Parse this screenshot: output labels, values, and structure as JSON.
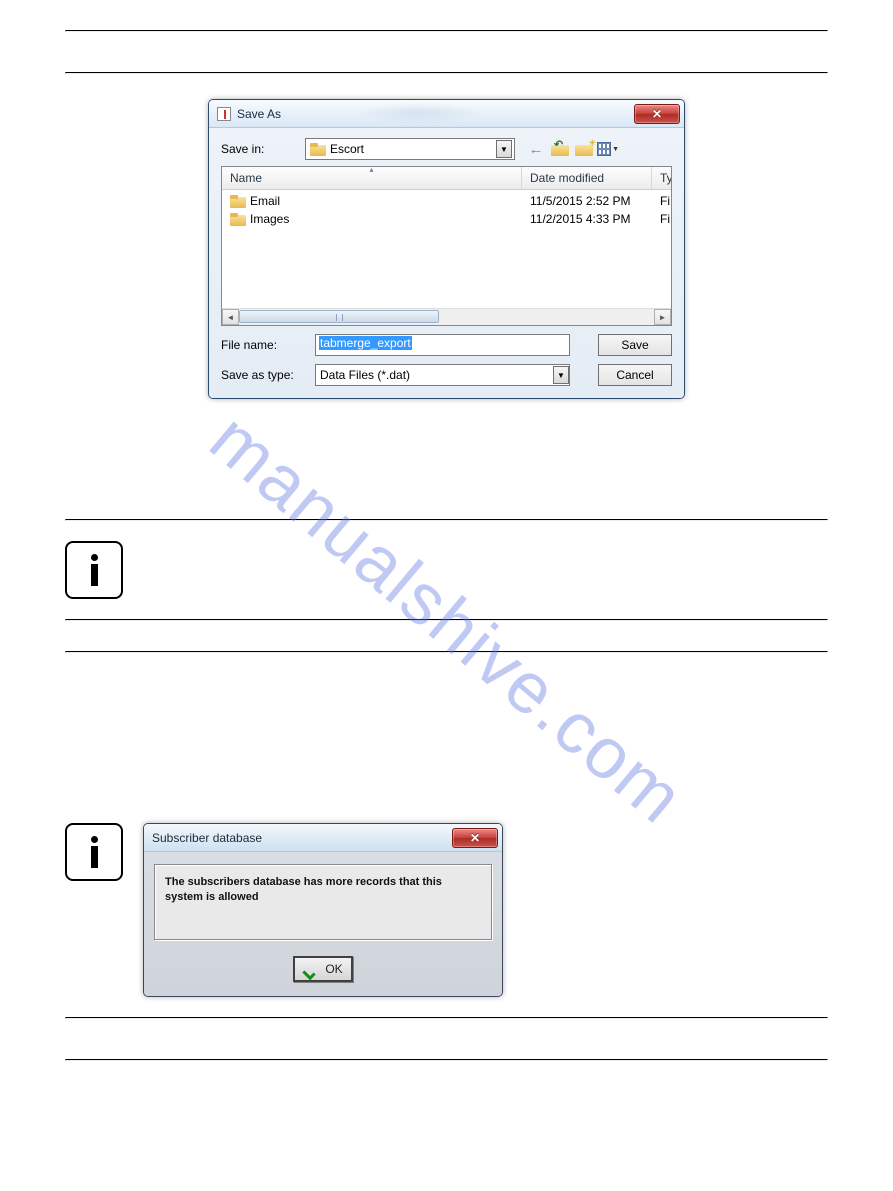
{
  "watermark": "manualshive.com",
  "saveas_dialog": {
    "title": "Save As",
    "labels": {
      "save_in": "Save in:",
      "file_name": "File name:",
      "save_as_type": "Save as type:"
    },
    "save_in_folder": "Escort",
    "columns": {
      "name": "Name",
      "date_modified": "Date modified",
      "type": "Ty"
    },
    "rows": [
      {
        "name": "Email",
        "date": "11/5/2015 2:52 PM",
        "type": "Fi"
      },
      {
        "name": "Images",
        "date": "11/2/2015 4:33 PM",
        "type": "Fi"
      }
    ],
    "file_name_value": "tabmerge_export",
    "save_as_type_value": "Data Files (*.dat)",
    "buttons": {
      "save": "Save",
      "cancel": "Cancel"
    },
    "close_glyph": "✕"
  },
  "subscriber_dialog": {
    "title": "Subscriber database",
    "message": "The subscribers database has more records that this system is allowed",
    "ok": "OK",
    "close_glyph": "✕"
  },
  "icons": {
    "dd_arrow": "▼",
    "left_arrow": "◄",
    "right_arrow": "►",
    "sort_arrow": "▴"
  }
}
